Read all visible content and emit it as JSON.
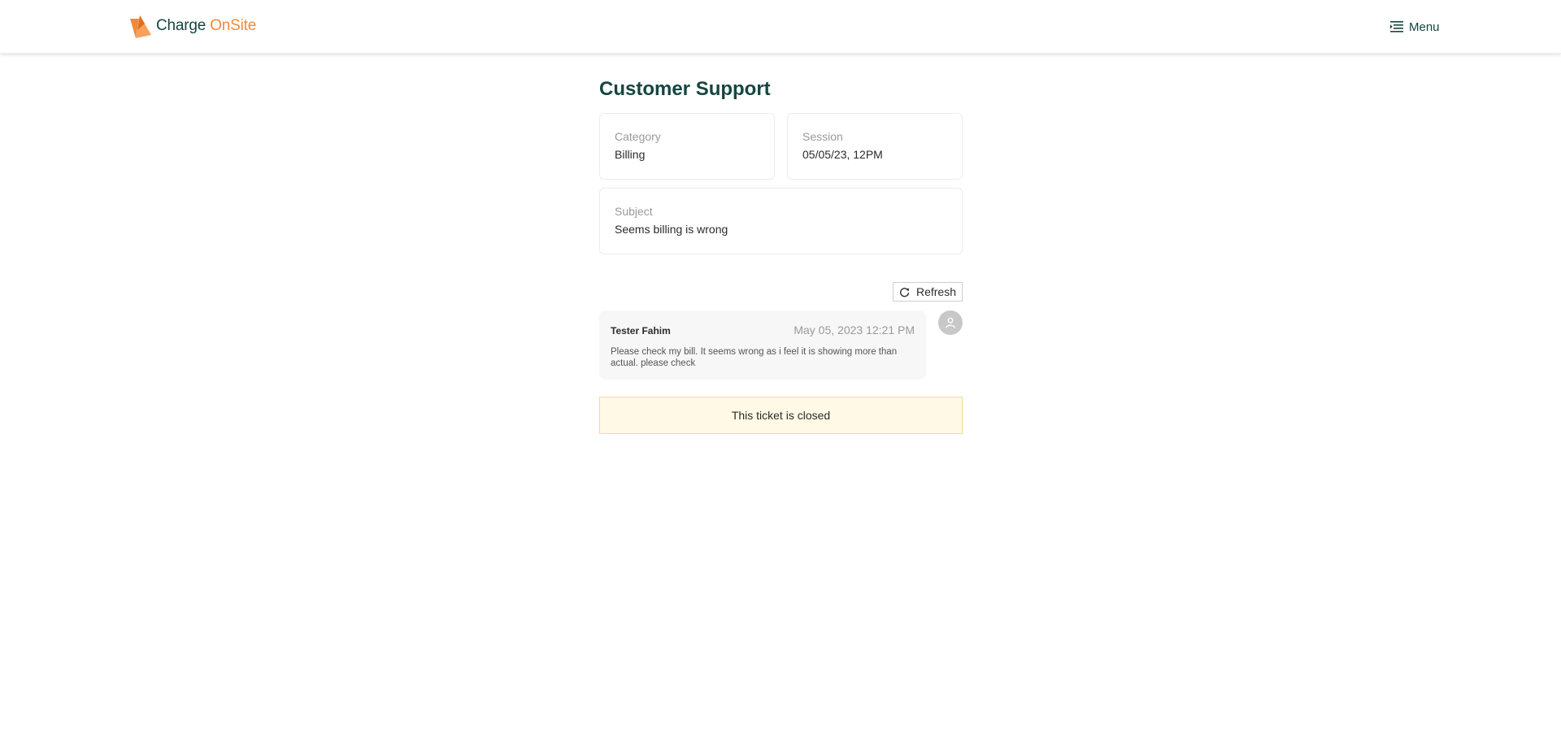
{
  "header": {
    "logo_part1": "Charge",
    "logo_part2": "OnSite",
    "menu_label": "Menu",
    "brand_color": "#15463f",
    "accent_color": "#f08a3c"
  },
  "page": {
    "title": "Customer Support"
  },
  "ticket": {
    "category_label": "Category",
    "category_value": "Billing",
    "session_label": "Session",
    "session_value": "05/05/23, 12PM",
    "subject_label": "Subject",
    "subject_value": "Seems billing is wrong"
  },
  "conversation": {
    "refresh_label": "Refresh",
    "messages": [
      {
        "author": "Tester Fahim",
        "timestamp": "May 05, 2023 12:21 PM",
        "body": "Please check my bill. It seems wrong as i feel it is showing more than actual. please check"
      }
    ]
  },
  "status": {
    "closed_text": "This ticket is closed",
    "banner_color": "#fff9e6"
  }
}
